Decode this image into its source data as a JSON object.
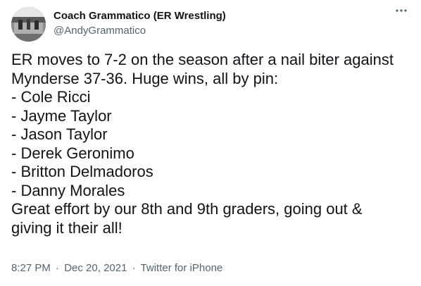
{
  "author": {
    "display_name": "Coach Grammatico (ER Wrestling)",
    "handle": "@AndyGrammatico"
  },
  "menu": {
    "icon": "more-horizontal-icon"
  },
  "tweet": {
    "lines": [
      "ER moves to 7-2 on the season after a nail biter against",
      "Mynderse 37-36. Huge wins, all by pin:",
      "- Cole Ricci",
      "- Jayme Taylor",
      "- Jason Taylor",
      "- Derek Geronimo",
      "- Britton Delmadoros",
      "- Danny Morales",
      "Great effort by our 8th and 9th graders, going out &",
      "giving it their all!"
    ]
  },
  "meta": {
    "time": "8:27 PM",
    "separator": "·",
    "date": "Dec 20, 2021",
    "source": "Twitter for iPhone"
  },
  "colors": {
    "text": "#0f1419",
    "secondary": "#536471",
    "background": "#ffffff"
  }
}
